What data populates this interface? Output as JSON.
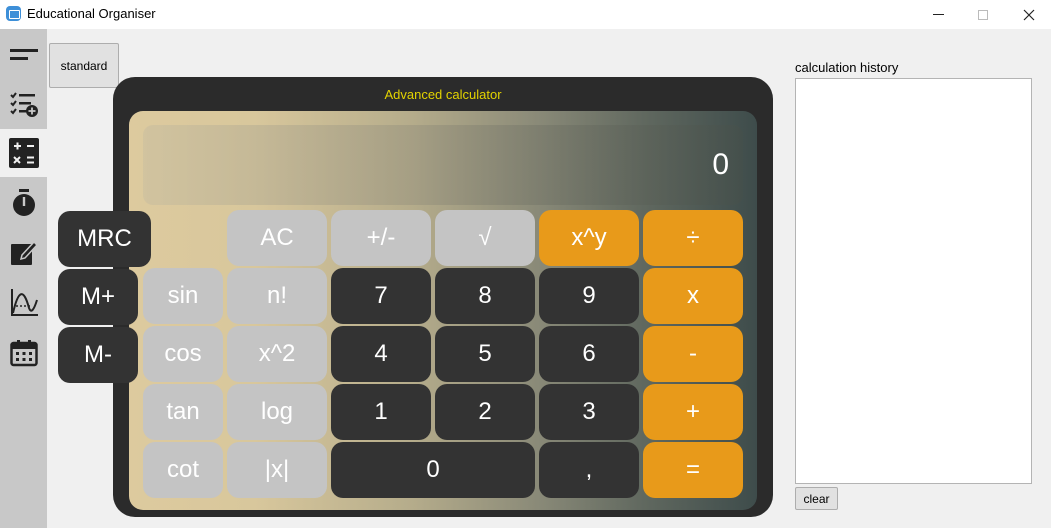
{
  "window": {
    "title": "Educational Organiser",
    "controls": {
      "minimize": "minimize",
      "maximize": "maximize",
      "close": "close"
    }
  },
  "sidebar": {
    "items": [
      {
        "name": "menu",
        "icon": "hamburger-menu-icon"
      },
      {
        "name": "tasks",
        "icon": "task-list-add-icon"
      },
      {
        "name": "calculator",
        "icon": "calculator-icon",
        "active": true
      },
      {
        "name": "timer",
        "icon": "stopwatch-icon"
      },
      {
        "name": "notes",
        "icon": "edit-note-icon"
      },
      {
        "name": "graph",
        "icon": "function-graph-icon"
      },
      {
        "name": "calendar",
        "icon": "calendar-icon"
      }
    ]
  },
  "mode_button": "standard",
  "calculator": {
    "title": "Advanced calculator",
    "display": "0",
    "memory_keys": [
      "MRC",
      "M+",
      "M-"
    ],
    "keys": {
      "ac": "AC",
      "sign": "+/-",
      "sqrt": "√",
      "pow": "x^y",
      "divide": "÷",
      "sin": "sin",
      "fact": "n!",
      "k7": "7",
      "k8": "8",
      "k9": "9",
      "multiply": "x",
      "cos": "cos",
      "sq": "x^2",
      "k4": "4",
      "k5": "5",
      "k6": "6",
      "minus": "-",
      "tan": "tan",
      "log": "log",
      "k1": "1",
      "k2": "2",
      "k3": "3",
      "plus": "+",
      "cot": "cot",
      "abs": "|x|",
      "k0": "0",
      "comma": ",",
      "equals": "="
    },
    "colors": {
      "accent": "#e89a1a",
      "dark_key": "#333333",
      "light_key": "#c4c4c4",
      "title": "#e3d300"
    }
  },
  "history": {
    "label": "calculation history",
    "entries": [],
    "clear_label": "clear"
  }
}
